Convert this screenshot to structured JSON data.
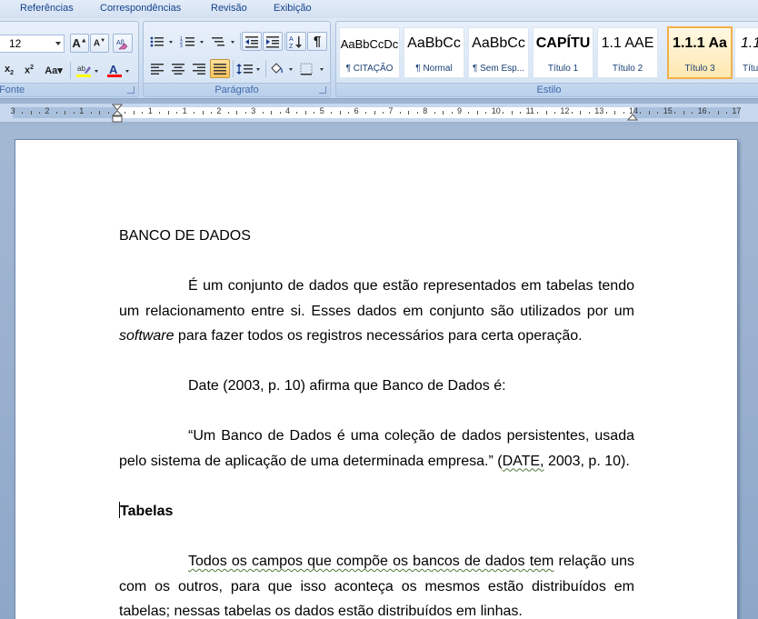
{
  "menu": {
    "tabs": [
      "Referências",
      "Correspondências",
      "Revisão",
      "Exibição"
    ]
  },
  "ribbon": {
    "font_group": {
      "label": "Fonte",
      "font_size": "12"
    },
    "paragraph_group": {
      "label": "Parágrafo"
    },
    "style_group": {
      "label": "Estilo"
    },
    "styles": [
      {
        "sample": "AaBbCcDc",
        "name": "¶ CITAÇÃO"
      },
      {
        "sample": "AaBbCc",
        "name": "¶ Normal"
      },
      {
        "sample": "AaBbCc",
        "name": "¶ Sem Esp..."
      },
      {
        "sample": "CAPÍTU",
        "name": "Título 1"
      },
      {
        "sample": "1.1  AAE",
        "name": "Título 2"
      },
      {
        "sample": "1.1.1  Aa",
        "name": "Título 3"
      },
      {
        "sample": "1.1",
        "name": "Títu"
      }
    ],
    "selected_style": "Título 3"
  },
  "ruler": {
    "numbers": [
      "3",
      "2",
      "1",
      "1",
      "1",
      "2",
      "3",
      "4",
      "5",
      "6",
      "7",
      "8",
      "9",
      "10",
      "11",
      "12",
      "13",
      "14",
      "15",
      "16",
      "17"
    ]
  },
  "document": {
    "heading": "BANCO DE DADOS",
    "p1": {
      "line1": "É um conjunto de dados que estão representados em tabelas tendo",
      "line2": "um relacionamento entre si. Esses dados em conjunto são utilizados por um",
      "line3_italic": "software",
      "line3_rest": " para fazer todos os registros necessários para certa operação."
    },
    "p2": "Date (2003, p. 10) afirma que Banco de Dados é:",
    "p3": {
      "line1": "“Um Banco de Dados é uma coleção de dados persistentes, usada",
      "line2_start": "pelo sistema de aplicação de uma determinada empresa.” (",
      "line2_marked": "DATE,",
      "line2_end": " 2003, p. 10)."
    },
    "section_title": "Tabelas",
    "p4": {
      "line1_marked": "Todos os campos que compõe os bancos de dados tem",
      "line1_rest": " relação uns",
      "line2": "com os outros, para que isso aconteça os mesmos estão distribuídos em",
      "line3": "tabelas; nessas tabelas os dados estão distribuídos em linhas."
    }
  }
}
